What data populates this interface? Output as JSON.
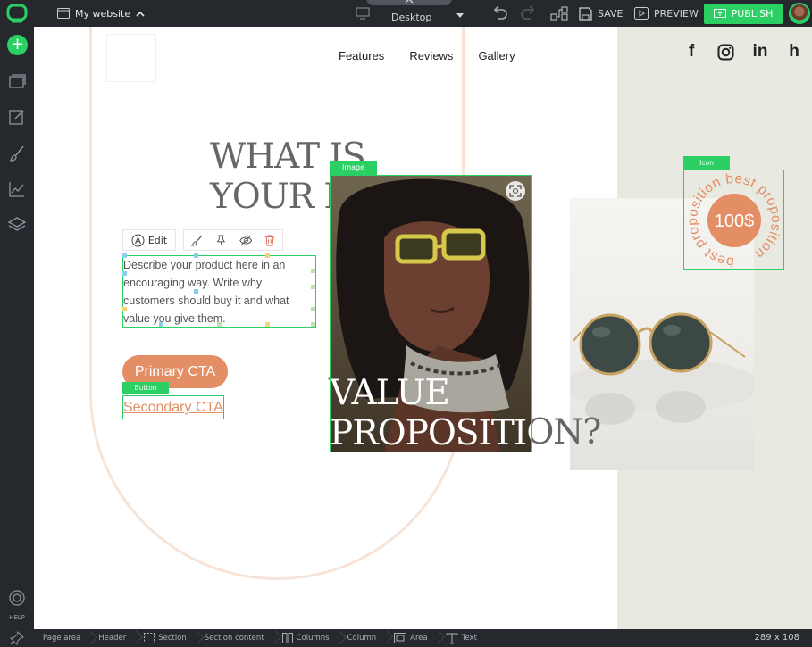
{
  "topbar": {
    "site_name": "My website",
    "device": "Desktop",
    "save_label": "SAVE",
    "preview_label": "PREVIEW",
    "publish_label": "PUBLISH"
  },
  "sidebar": {
    "help_label": "HELP"
  },
  "statusbar": {
    "crumbs": [
      "Page area",
      "Header",
      "Section",
      "Section content",
      "Columns",
      "Column",
      "Area",
      "Text"
    ],
    "dimensions": "289 x 108"
  },
  "page": {
    "nav": [
      "Features",
      "Reviews",
      "Gallery"
    ],
    "heading_line1": "WHAT IS",
    "heading_line2": "YOUR MAIN",
    "heading_line3": "VALUE",
    "heading_line4": "PROPOSITION?",
    "description": "Describe your product here in an encouraging way. Write why customers should buy it and what value you give them.",
    "primary_cta": "Primary CTA",
    "secondary_cta": "Secondary CTA",
    "badge_text": "best proposition best proposition",
    "badge_price": "100$"
  },
  "editor": {
    "edit_label": "Edit",
    "image_tag": "Image",
    "button_tag": "Button",
    "icon_tag": "Icon"
  },
  "colors": {
    "accent_green": "#2bcf63",
    "brand_orange": "#e38e64",
    "chrome_dark": "#25292e"
  }
}
